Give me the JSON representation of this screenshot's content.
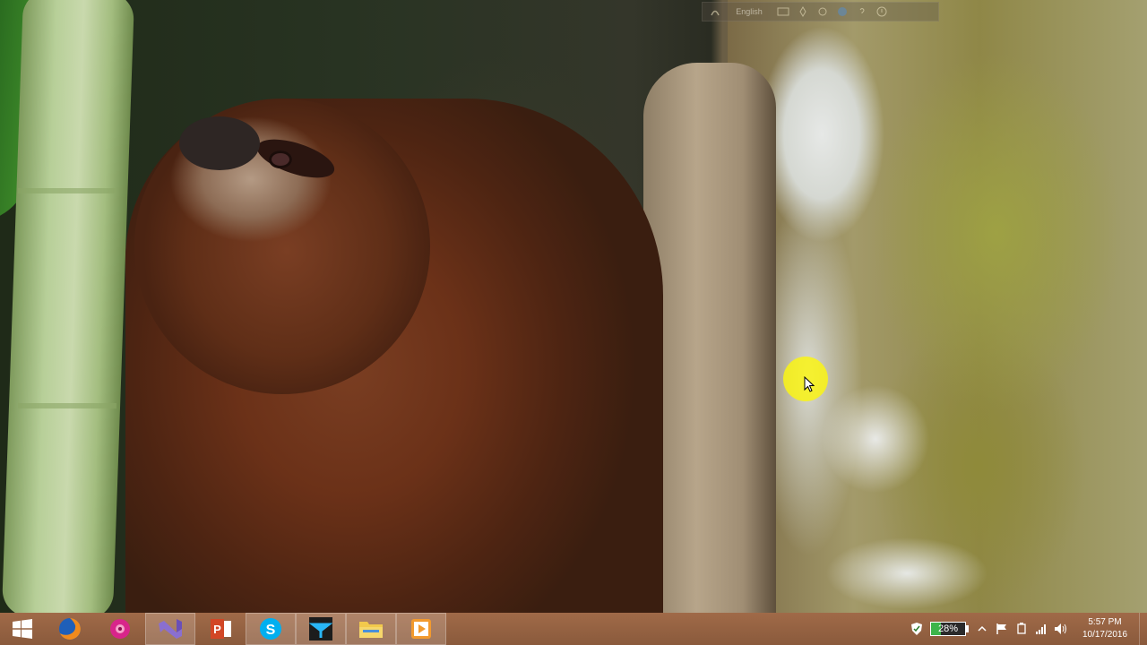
{
  "language_bar": {
    "language": "English",
    "icons": [
      "ime-icon",
      "keyboard-icon",
      "pen-icon",
      "settings-icon",
      "globe-icon",
      "help-icon",
      "options-icon"
    ]
  },
  "taskbar": {
    "start_icon": "windows-logo-icon",
    "pinned": [
      {
        "name": "firefox",
        "icon": "firefox-icon",
        "active": false
      },
      {
        "name": "app-flower",
        "icon": "flower-icon",
        "active": false
      },
      {
        "name": "visual-studio",
        "icon": "visual-studio-icon",
        "active": true
      },
      {
        "name": "powerpoint",
        "icon": "powerpoint-icon",
        "active": false
      },
      {
        "name": "skype",
        "icon": "skype-icon",
        "active": true
      },
      {
        "name": "app-telerik",
        "icon": "telerik-icon",
        "active": true
      },
      {
        "name": "file-explorer",
        "icon": "folder-icon",
        "active": true
      },
      {
        "name": "media-player",
        "icon": "media-player-icon",
        "active": true
      }
    ]
  },
  "tray": {
    "battery_percent": "28%",
    "battery_level": 0.28,
    "time": "5:57 PM",
    "date": "10/17/2016"
  },
  "colors": {
    "taskbar": "#9a6544",
    "battery_fill": "#3db54a",
    "cursor_halo": "#f5ef14"
  }
}
